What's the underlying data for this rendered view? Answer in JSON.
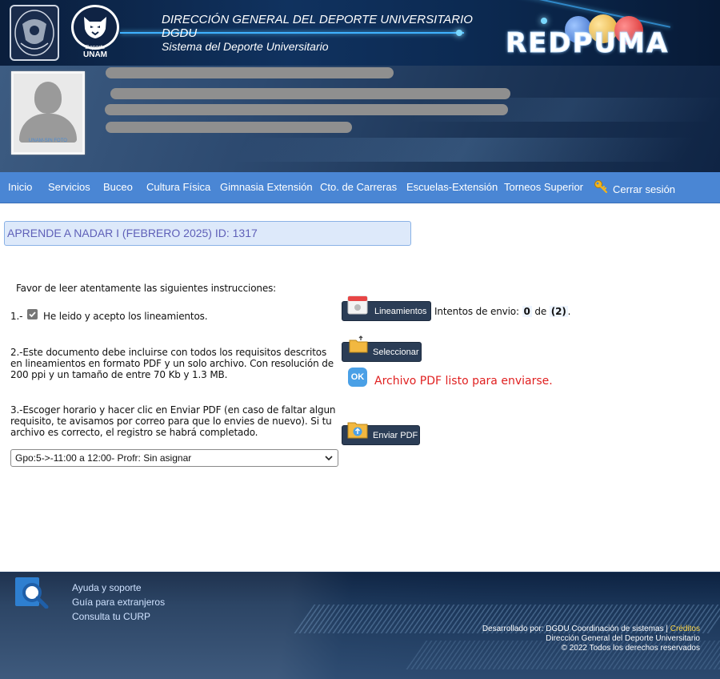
{
  "header": {
    "line1": "DIRECCIÓN GENERAL DEL DEPORTE UNIVERSITARIO",
    "line2": "DGDU",
    "line3": "Sistema del Deporte Universitario",
    "brand": "REDPUMA",
    "puma_caption": "UNAM",
    "puma_sub": "Deporte"
  },
  "profile": {
    "photo_caption": "UNAM-SIN FOTO"
  },
  "nav": {
    "items": [
      {
        "label": "Inicio"
      },
      {
        "label": "Servicios"
      },
      {
        "label": "Buceo"
      },
      {
        "label": "Cultura Física"
      },
      {
        "label": "Gimnasia Extensión"
      },
      {
        "label": "Cto. de Carreras"
      },
      {
        "label": "Escuelas-Extensión"
      },
      {
        "label": "Torneos Superior"
      }
    ],
    "logout": "Cerrar sesión"
  },
  "course": {
    "title": "APRENDE A NADAR I (FEBRERO 2025) ID: 1317"
  },
  "instructions": {
    "intro": "Favor de leer atentamente las siguientes instrucciones:",
    "step1_num": "1.-",
    "step1_text": "He leido y acepto los lineamientos.",
    "step1_checked": true,
    "step2": "2.-Este documento debe incluirse con todos los requisitos descritos en lineamientos en formato PDF y un solo archivo. Con resolución de 200 ppi y un tamaño de entre 70 Kb y 1.3 MB.",
    "step3": "3.-Escoger horario y hacer clic en Enviar PDF (en caso de faltar algun requisito, te avisamos por correo para que lo envies de nuevo). Si tu archivo es correcto, el registro se habrá completado."
  },
  "actions": {
    "lineamientos_label": "Lineamientos",
    "attempts_label": "Intentos de envio:",
    "attempts_used": "0",
    "attempts_of": "de",
    "attempts_max": "(2)",
    "attempts_end": ".",
    "select_label": "Seleccionar",
    "ok_label": "OK",
    "ready_text": "Archivo PDF listo para enviarse.",
    "send_label": "Enviar PDF"
  },
  "schedule": {
    "selected": "Gpo:5->-11:00 a 12:00- Profr: Sin asignar"
  },
  "footer": {
    "links": [
      "Ayuda y soporte",
      "Guía para extranjeros",
      "Consulta tu CURP"
    ],
    "dev_text": "Desarrollado por: DGDU Coordinación de sistemas |",
    "credits_link": "Créditos",
    "org": "Dirección General del Deporte Universitario",
    "rights": "© 2022 Todos los derechos reservados"
  },
  "colors": {
    "nav_bg": "#4a86d4",
    "button_bg": "#2b3d56",
    "ready_red": "#e02020",
    "title_text": "#5f60b8"
  }
}
